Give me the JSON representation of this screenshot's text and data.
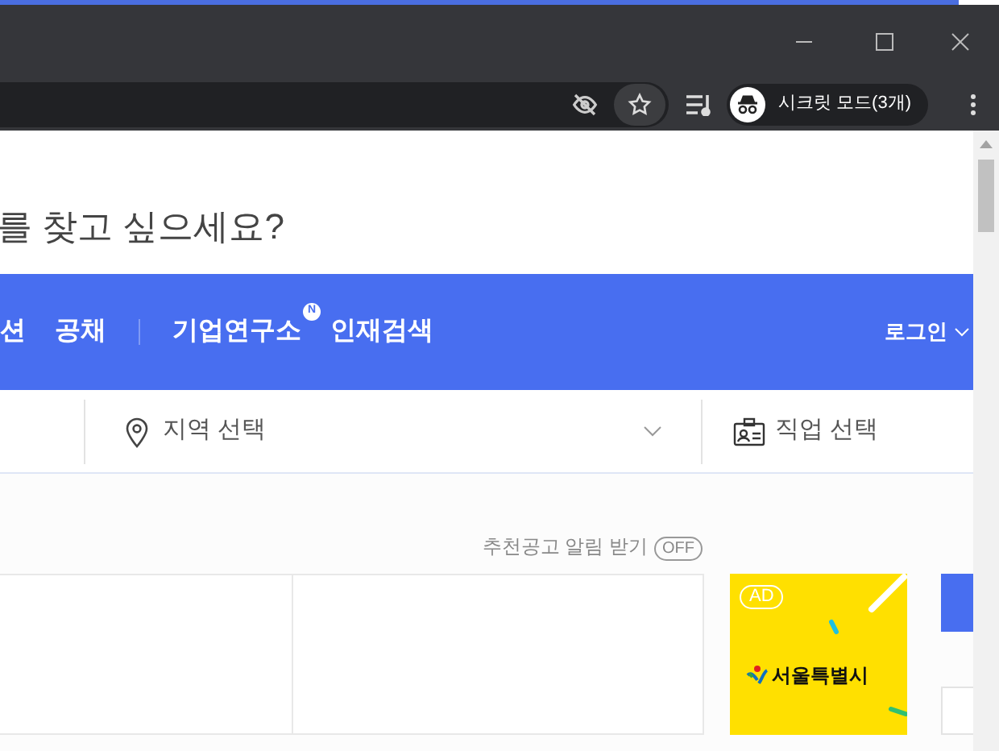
{
  "browser": {
    "profile_label": "시크릿 모드(3개)"
  },
  "page": {
    "heading": "를 찾고 싶으세요?",
    "nav": {
      "items": [
        {
          "kind": "link",
          "label": "션"
        },
        {
          "kind": "link",
          "label": "공채"
        },
        {
          "kind": "divider"
        },
        {
          "kind": "link",
          "label": "기업연구소",
          "badge": "N"
        },
        {
          "kind": "link",
          "label": "인재검색"
        }
      ],
      "login": "로그인"
    },
    "search": {
      "fields": [
        {
          "kind": "location",
          "placeholder": "지역 선택"
        },
        {
          "kind": "job",
          "placeholder": "직업 선택"
        }
      ]
    },
    "alert": {
      "label": "추천공고 알림 받기",
      "toggle": "OFF",
      "on": false
    },
    "ad": {
      "badge": "AD",
      "brand": "서울특별시"
    }
  }
}
